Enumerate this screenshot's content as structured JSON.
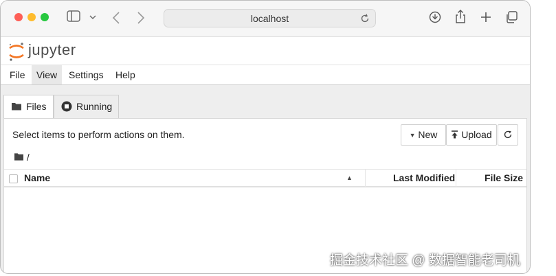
{
  "browser": {
    "url": "localhost",
    "icons": [
      "sidebar-icon",
      "chevron-down-icon",
      "back-icon",
      "forward-icon",
      "reload-icon",
      "download-icon",
      "share-icon",
      "new-tab-icon",
      "tabs-overview-icon"
    ]
  },
  "app": {
    "logo_text": "jupyter",
    "colors": {
      "logo_orange": "#f37726",
      "menu_active_bg": "#e8e8e8"
    }
  },
  "menu": {
    "items": [
      {
        "label": "File"
      },
      {
        "label": "View"
      },
      {
        "label": "Settings"
      },
      {
        "label": "Help"
      }
    ],
    "active": "View"
  },
  "tabs": [
    {
      "label": "Files",
      "icon": "folder-icon",
      "active": true
    },
    {
      "label": "Running",
      "icon": "stop-circle-icon",
      "active": false
    }
  ],
  "toolbar": {
    "hint": "Select items to perform actions on them.",
    "new_label": "New",
    "upload_label": "Upload",
    "refresh_icon": "refresh-icon"
  },
  "breadcrumb": {
    "path": "/"
  },
  "table": {
    "columns": {
      "name": "Name",
      "modified": "Last Modified",
      "size": "File Size"
    },
    "sort": "ascending"
  },
  "watermark": "掘金技术社区 @ 数据智能老司机"
}
